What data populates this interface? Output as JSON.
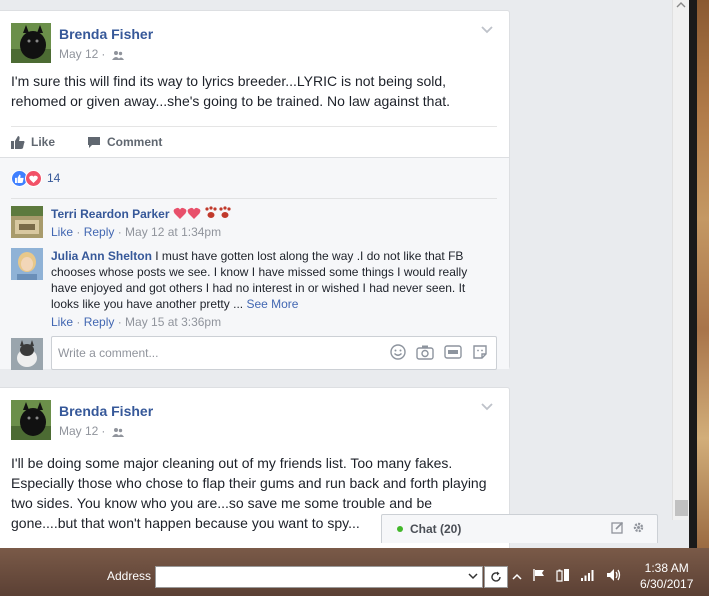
{
  "post1": {
    "author": "Brenda Fisher",
    "date": "May 12",
    "text": "I'm sure this will find its way to lyrics breeder...LYRIC is not being sold, rehomed or given away...she's going to be trained. No law against that.",
    "like_label": "Like",
    "comment_label": "Comment",
    "reaction_count": "14",
    "comments": [
      {
        "name": "Terri Reardon Parker",
        "text": "",
        "like": "Like",
        "reply": "Reply",
        "time": "May 12 at 1:34pm"
      },
      {
        "name": "Julia Ann Shelton",
        "text": "I must have gotten lost along the way .I do not like that FB chooses whose posts we see. I know I have missed some things I would really have enjoyed and got others I had no interest in or wished I had never seen. It looks like you have another pretty ...",
        "see_more": "See More",
        "like": "Like",
        "reply": "Reply",
        "time": "May 15 at 3:36pm"
      }
    ],
    "write_placeholder": "Write a comment..."
  },
  "post2": {
    "author": "Brenda Fisher",
    "date": "May 12",
    "text": "I'll be doing some major cleaning out of my friends list. Too many fakes. Especially those who chose to flap their gums and run back and forth playing two sides. You know who you are...so save me some trouble and be gone....but that won't happen because you want to spy..."
  },
  "chat": {
    "label": "Chat (20)"
  },
  "taskbar": {
    "address_label": "Address",
    "time": "1:38 AM",
    "date": "6/30/2017"
  },
  "colors": {
    "link": "#365899",
    "like_reaction": "#4080ff",
    "love_reaction": "#f25268",
    "online": "#42b72a"
  }
}
